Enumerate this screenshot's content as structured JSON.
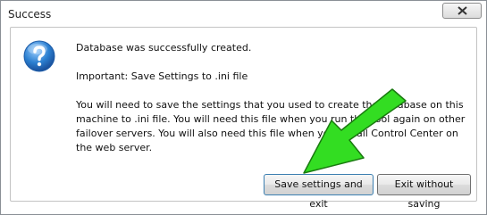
{
  "window": {
    "title": "Success"
  },
  "dialog": {
    "icon": "question-icon",
    "line1": "Database was successfully created.",
    "line2": "Important: Save Settings to .ini file",
    "line3": "You will need to save the settings that you used to create the database on this machine to .ini file. You will need this file when you run this tool again on other failover servers. You will also need this file when you install Control Center on the web server."
  },
  "buttons": {
    "save_label": "Save settings and exit",
    "exit_label": "Exit without saving"
  },
  "colors": {
    "accent": "#2b7fd0",
    "arrow": "#33dd22"
  }
}
